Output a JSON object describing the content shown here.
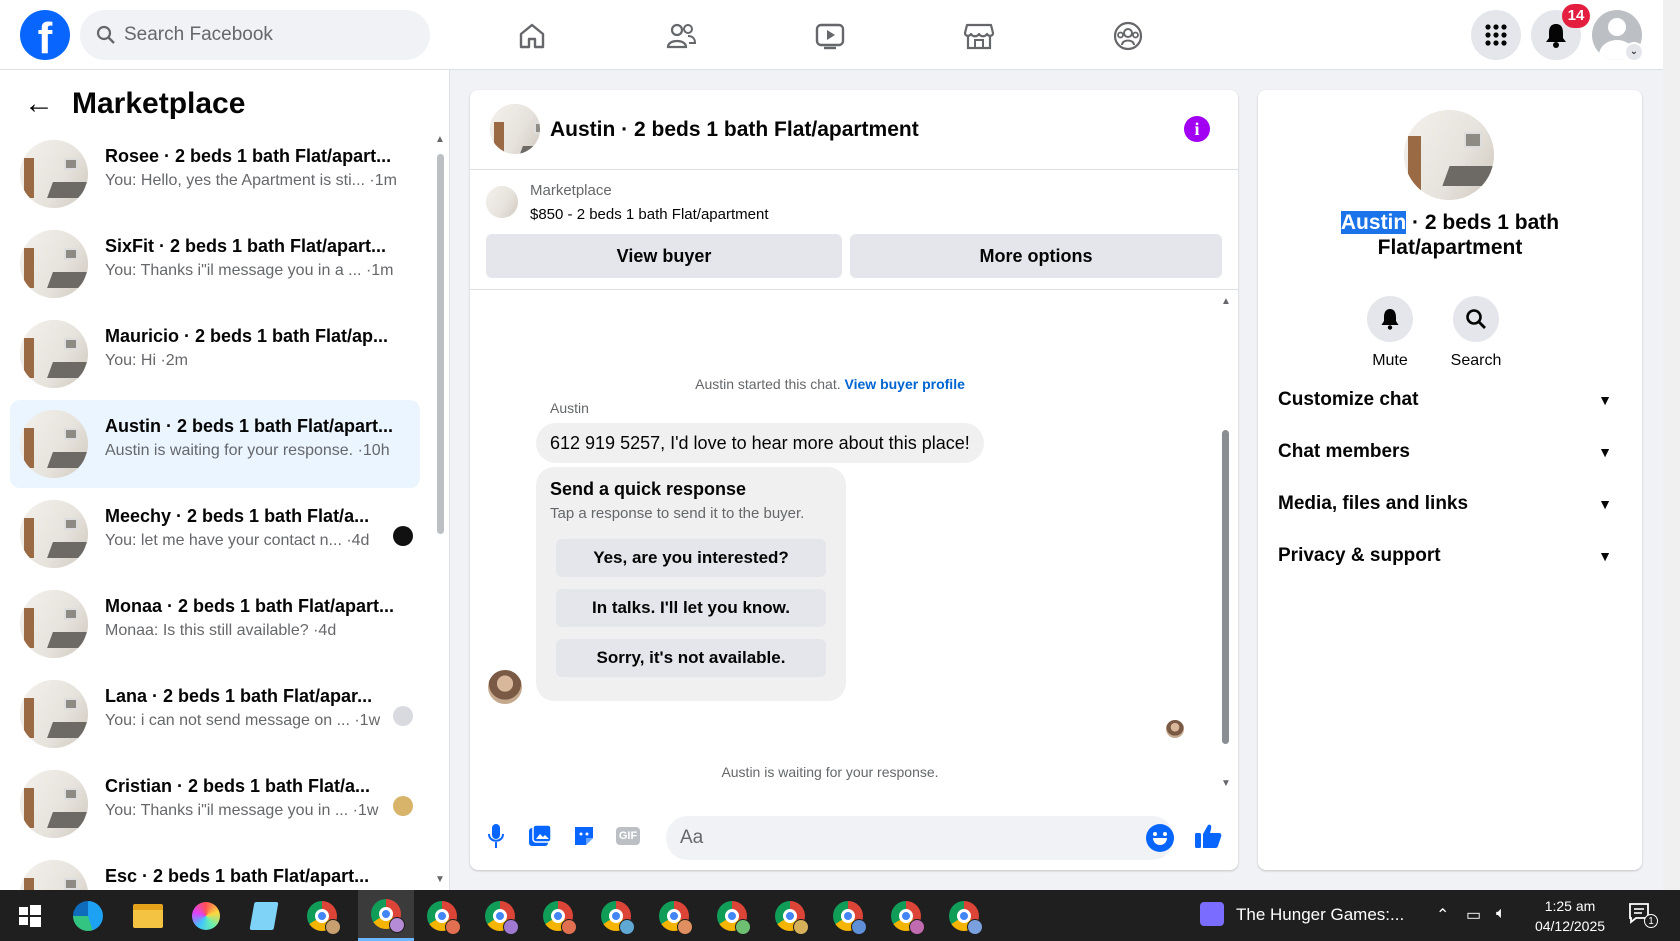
{
  "topbar": {
    "logo": "f",
    "search_placeholder": "Search Facebook",
    "notification_count": "14"
  },
  "left": {
    "title": "Marketplace",
    "conversations": [
      {
        "title": "Rosee · 2 beds 1 bath Flat/apart...",
        "subtitle": "You: Hello, yes the Apartment is sti... ·1m"
      },
      {
        "title": "SixFit · 2 beds 1 bath Flat/apart...",
        "subtitle": "You: Thanks i\"il message you in a ... ·1m"
      },
      {
        "title": "Mauricio · 2 beds 1 bath Flat/ap...",
        "subtitle": "You: Hi ·2m"
      },
      {
        "title": "Austin · 2 beds 1 bath Flat/apart...",
        "subtitle": "Austin is waiting for your response. ·10h"
      },
      {
        "title": "Meechy · 2 beds 1 bath Flat/a...",
        "subtitle": "You: let me have your contact n... ·4d"
      },
      {
        "title": "Monaa · 2 beds 1 bath Flat/apart...",
        "subtitle": "Monaa: Is this still available? ·4d"
      },
      {
        "title": "Lana · 2 beds 1 bath Flat/apar...",
        "subtitle": "You: i can not send message on ... ·1w"
      },
      {
        "title": "Cristian · 2 beds 1 bath Flat/a...",
        "subtitle": "You: Thanks i\"il message you in ... ·1w"
      },
      {
        "title": "Esc · 2 beds 1 bath Flat/apart...",
        "subtitle": ""
      }
    ]
  },
  "chat": {
    "title": "Austin · 2 beds 1 bath Flat/apartment",
    "listing_label": "Marketplace",
    "listing_price": "$850 - 2 beds 1 bath Flat/apartment",
    "view_buyer": "View buyer",
    "more_options": "More options",
    "started_text": "Austin started this chat.",
    "view_profile_link": "View buyer profile",
    "sender_name": "Austin",
    "message": "612 919 5257, I'd love to hear more about this place!",
    "quick_title": "Send a quick response",
    "quick_hint": "Tap a response to send it to the buyer.",
    "quick_options": [
      "Yes, are you interested?",
      "In talks. I'll let you know.",
      "Sorry, it's not available."
    ],
    "waiting_text": "Austin is waiting for your response.",
    "composer_placeholder": "Aa",
    "gif_label": "GIF"
  },
  "info": {
    "name_highlight": "Austin",
    "title_rest": " · 2 beds 1 bath Flat/apartment",
    "mute_label": "Mute",
    "search_label": "Search",
    "sections": [
      "Customize chat",
      "Chat members",
      "Media, files and links",
      "Privacy & support"
    ]
  },
  "taskbar": {
    "media_title": "The Hunger Games:...",
    "time": "1:25 am",
    "date": "04/12/2025",
    "action_center_count": "1"
  },
  "colors": {
    "brand": "#0866ff",
    "badge": "#e41e3f",
    "info_icon": "#a100f2",
    "active_row": "#ebf5ff"
  }
}
